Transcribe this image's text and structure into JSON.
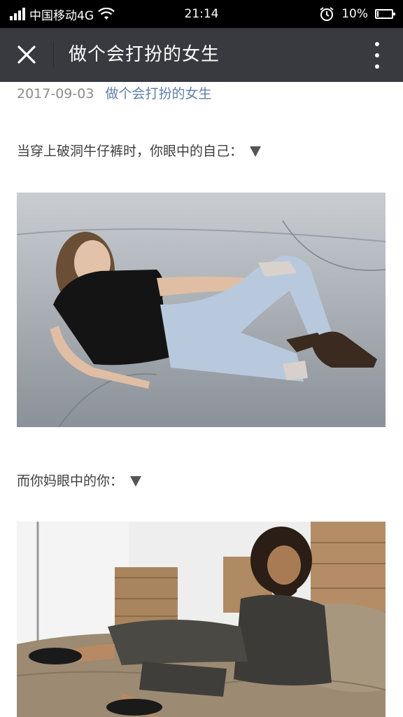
{
  "status_bar": {
    "carrier": "中国移动4G",
    "time": "21:14",
    "battery": "10%",
    "battery_level": 0.1
  },
  "nav": {
    "title": "做个会打扮的女生"
  },
  "article": {
    "date": "2017-09-03",
    "account": "做个会打扮的女生",
    "para1": "当穿上破洞牛仔裤时，你眼中的自己：",
    "para2": "而你妈眼中的你："
  },
  "colors": {
    "status_bg": "#000000",
    "nav_bg": "#393a3f",
    "link": "#607fa6",
    "meta": "#8c8c8c"
  }
}
